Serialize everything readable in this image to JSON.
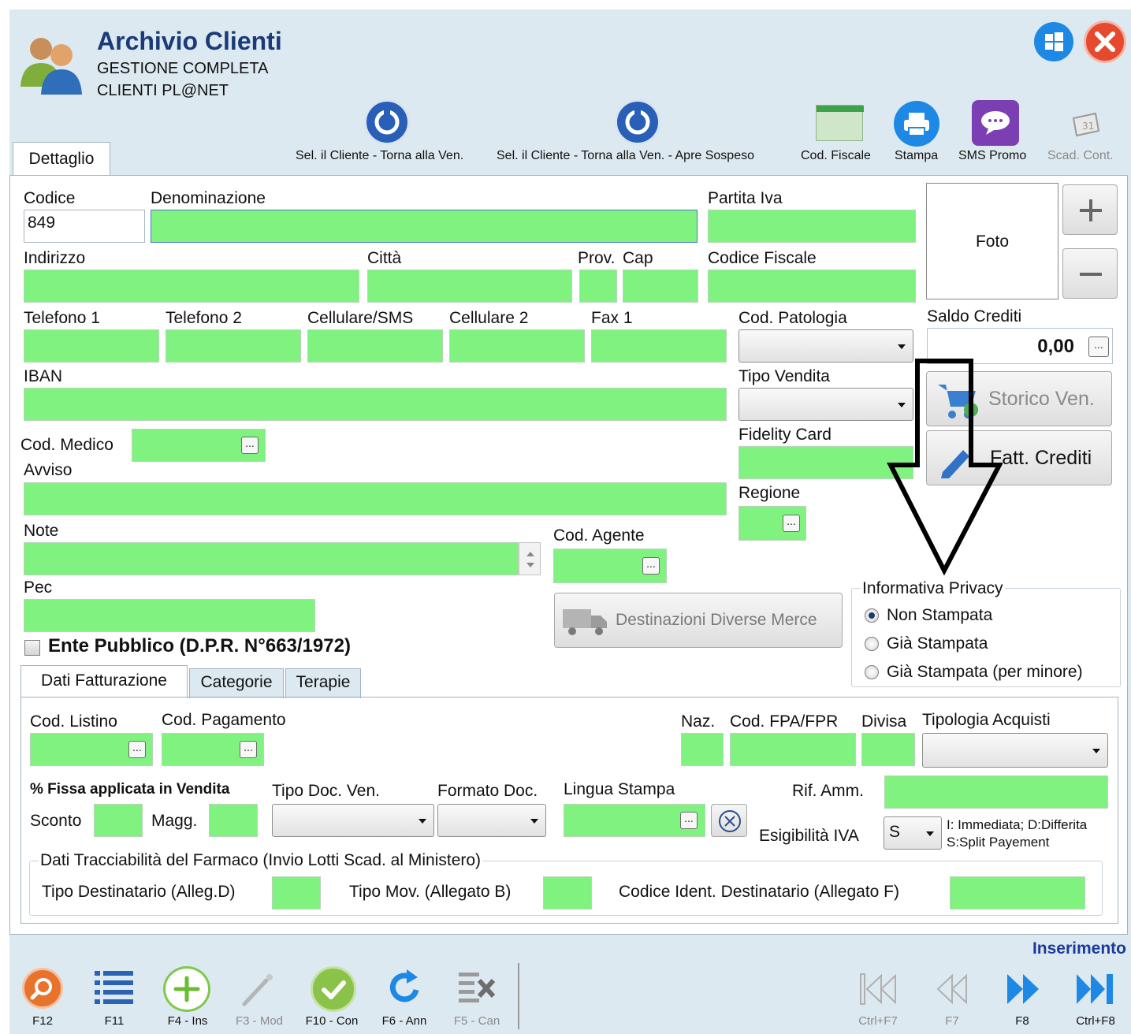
{
  "header": {
    "title": "Archivio Clienti",
    "subtitle_line1": "GESTIONE COMPLETA",
    "subtitle_line2": "CLIENTI PL@NET"
  },
  "toolbar": {
    "sel_cliente": "Sel. il Cliente - Torna alla Ven.",
    "sel_cliente_sospeso": "Sel. il Cliente - Torna alla Ven. - Apre Sospeso",
    "cod_fiscale": "Cod. Fiscale",
    "stampa": "Stampa",
    "sms_promo": "SMS Promo",
    "scad_cont": "Scad. Cont."
  },
  "tabs": {
    "dettaglio": "Dettaglio"
  },
  "form": {
    "codice_label": "Codice",
    "codice_value": "849",
    "denominazione_label": "Denominazione",
    "partita_iva_label": "Partita Iva",
    "indirizzo_label": "Indirizzo",
    "citta_label": "Città",
    "prov_label": "Prov.",
    "cap_label": "Cap",
    "codice_fiscale_label": "Codice Fiscale",
    "telefono1_label": "Telefono 1",
    "telefono2_label": "Telefono 2",
    "cellulare_sms_label": "Cellulare/SMS",
    "cellulare2_label": "Cellulare 2",
    "fax1_label": "Fax 1",
    "cod_patologia_label": "Cod. Patologia",
    "iban_label": "IBAN",
    "tipo_vendita_label": "Tipo Vendita",
    "cod_medico_label": "Cod. Medico",
    "fidelity_card_label": "Fidelity Card",
    "avviso_label": "Avviso",
    "regione_label": "Regione",
    "note_label": "Note",
    "cod_agente_label": "Cod. Agente",
    "pec_label": "Pec",
    "ente_pubblico_label": "Ente Pubblico (D.P.R. N°663/1972)",
    "destinazioni_button": "Destinazioni Diverse Merce"
  },
  "side": {
    "foto_label": "Foto",
    "saldo_crediti_label": "Saldo Crediti",
    "saldo_crediti_value": "0,00",
    "storico_ven": "Storico Ven.",
    "fatt_crediti": "Fatt. Crediti"
  },
  "privacy": {
    "legend": "Informativa Privacy",
    "options": [
      "Non Stampata",
      "Già Stampata",
      "Già Stampata (per minore)"
    ],
    "selected": "Non Stampata"
  },
  "subtabs": [
    "Dati Fatturazione",
    "Categorie",
    "Terapie"
  ],
  "fatturazione": {
    "cod_listino_label": "Cod. Listino",
    "cod_pagamento_label": "Cod. Pagamento",
    "naz_label": "Naz.",
    "cod_fpa_label": "Cod. FPA/FPR",
    "divisa_label": "Divisa",
    "tipologia_acquisti_label": "Tipologia Acquisti",
    "perc_fissa_label": "% Fissa applicata in Vendita",
    "tipo_doc_ven_label": "Tipo Doc. Ven.",
    "formato_doc_label": "Formato Doc.",
    "lingua_stampa_label": "Lingua Stampa",
    "rif_amm_label": "Rif. Amm.",
    "sconto_label": "Sconto",
    "magg_label": "Magg.",
    "esigibilita_label": "Esigibilità IVA",
    "esigibilita_value": "S",
    "esigibilita_hint1": "I: Immediata; D:Differita",
    "esigibilita_hint2": "S:Split Payement",
    "tracciabilita_legend": "Dati Tracciabilità del Farmaco (Invio Lotti Scad. al Ministero)",
    "tipo_destinatario_label": "Tipo Destinatario (Alleg.D)",
    "tipo_mov_label": "Tipo Mov. (Allegato B)",
    "codice_ident_label": "Codice Ident. Destinatario (Allegato F)"
  },
  "status": {
    "mode": "Inserimento"
  },
  "bottom_bar": {
    "keys": [
      "F12",
      "F11",
      "F4 - Ins",
      "F3 - Mod",
      "F10 - Con",
      "F6 - Ann",
      "F5 - Can"
    ],
    "nav": [
      "Ctrl+F7",
      "F7",
      "F8",
      "Ctrl+F8"
    ]
  },
  "colors": {
    "field_green": "#7ff27f",
    "window_bg": "#dde9f0",
    "accent_blue": "#1e88e5",
    "close_red": "#e64a2e"
  }
}
